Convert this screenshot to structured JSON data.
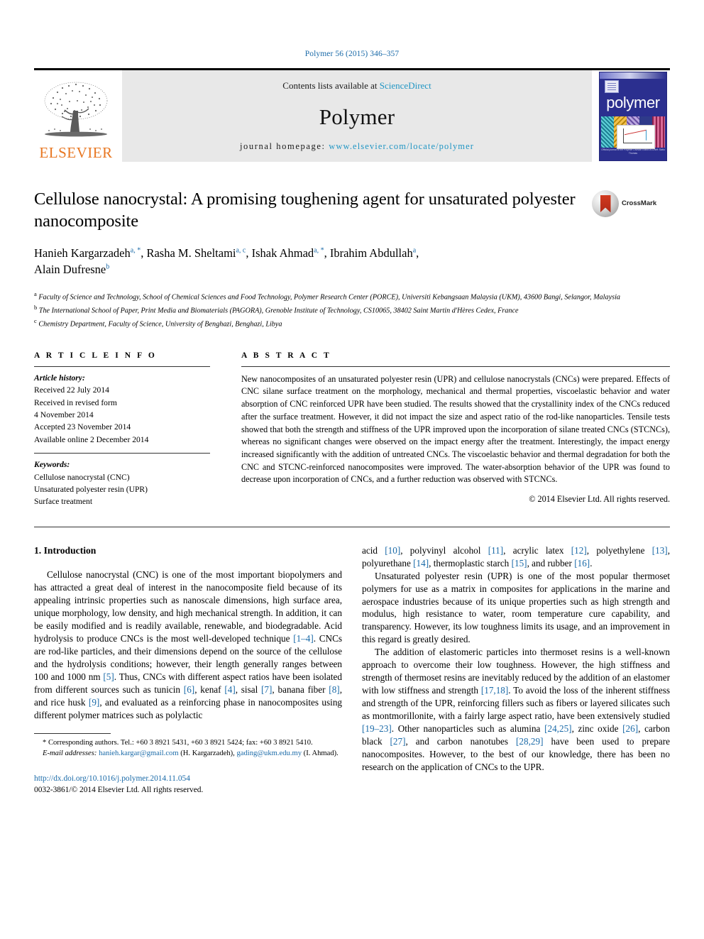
{
  "running_head": "Polymer 56 (2015) 346–357",
  "masthead": {
    "publisher": "ELSEVIER",
    "contents_prefix": "Contents lists available at ",
    "contents_link": "ScienceDirect",
    "journal_title": "Polymer",
    "homepage_prefix": "journal homepage: ",
    "homepage_url": "www.elsevier.com/locate/polymer",
    "cover_word": "polymer",
    "cover_footer": "Official journal of the Polymer Division\nEditor-in-Chief: Sabu Thomas"
  },
  "article": {
    "title": "Cellulose nanocrystal: A promising toughening agent for unsaturated polyester nanocomposite",
    "crossmark_label": "CrossMark",
    "authors": [
      {
        "name": "Hanieh Kargarzadeh",
        "marks": "a, *",
        "sep": ", "
      },
      {
        "name": "Rasha M. Sheltami",
        "marks": "a, c",
        "sep": ", "
      },
      {
        "name": "Ishak Ahmad",
        "marks": "a, *",
        "sep": ", "
      },
      {
        "name": "Ibrahim Abdullah",
        "marks": "a",
        "sep": ","
      },
      {
        "name": "Alain Dufresne",
        "marks": "b",
        "sep": ""
      }
    ],
    "affiliations": [
      {
        "mark": "a",
        "text": "Faculty of Science and Technology, School of Chemical Sciences and Food Technology, Polymer Research Center (PORCE), Universiti Kebangsaan Malaysia (UKM), 43600 Bangi, Selangor, Malaysia"
      },
      {
        "mark": "b",
        "text": "The International School of Paper, Print Media and Biomaterials (PAGORA), Grenoble Institute of Technology, CS10065, 38402 Saint Martin d'Hères Cedex, France"
      },
      {
        "mark": "c",
        "text": "Chemistry Department, Faculty of Science, University of Benghazi, Benghazi, Libya"
      }
    ]
  },
  "article_info": {
    "heading": "A R T I C L E   I N F O",
    "history_label": "Article history:",
    "history": [
      "Received 22 July 2014",
      "Received in revised form",
      "4 November 2014",
      "Accepted 23 November 2014",
      "Available online 2 December 2014"
    ],
    "keywords_label": "Keywords:",
    "keywords": [
      "Cellulose nanocrystal (CNC)",
      "Unsaturated polyester resin (UPR)",
      "Surface treatment"
    ]
  },
  "abstract": {
    "heading": "A B S T R A C T",
    "text": "New nanocomposites of an unsaturated polyester resin (UPR) and cellulose nanocrystals (CNCs) were prepared. Effects of CNC silane surface treatment on the morphology, mechanical and thermal properties, viscoelastic behavior and water absorption of CNC reinforced UPR have been studied. The results showed that the crystallinity index of the CNCs reduced after the surface treatment. However, it did not impact the size and aspect ratio of the rod-like nanoparticles. Tensile tests showed that both the strength and stiffness of the UPR improved upon the incorporation of silane treated CNCs (STCNCs), whereas no significant changes were observed on the impact energy after the treatment. Interestingly, the impact energy increased significantly with the addition of untreated CNCs. The viscoelastic behavior and thermal degradation for both the CNC and STCNC-reinforced nanocomposites were improved. The water-absorption behavior of the UPR was found to decrease upon incorporation of CNCs, and a further reduction was observed with STCNCs.",
    "copyright": "© 2014 Elsevier Ltd. All rights reserved."
  },
  "body": {
    "section_number_title": "1.  Introduction",
    "left_paragraph_1_a": "Cellulose nanocrystal (CNC) is one of the most important biopolymers and has attracted a great deal of interest in the nanocomposite field because of its appealing intrinsic properties such as nanoscale dimensions, high surface area, unique morphology, low density, and high mechanical strength. In addition, it can be easily modified and is readily available, renewable, and biodegradable. Acid hydrolysis to produce CNCs is the most well-developed technique ",
    "ref_1_4": "[1–4]",
    "left_paragraph_1_b": ". CNCs are rod-like particles, and their dimensions depend on the source of the cellulose and the hydrolysis conditions; however, their length generally ranges between 100 and 1000 nm ",
    "ref_5": "[5]",
    "left_paragraph_1_c": ". Thus, CNCs with different aspect ratios have been isolated from different sources such as tunicin ",
    "ref_6": "[6]",
    "left_paragraph_1_d": ", kenaf ",
    "ref_4": "[4]",
    "left_paragraph_1_e": ", sisal ",
    "ref_7": "[7]",
    "left_paragraph_1_f": ", banana fiber ",
    "ref_8": "[8]",
    "left_paragraph_1_g": ", and rice husk ",
    "ref_9": "[9]",
    "left_paragraph_1_h": ", and evaluated as a reinforcing phase in nanocomposites using different polymer matrices such as polylactic",
    "right_paragraph_1_a": "acid ",
    "ref_10": "[10]",
    "right_paragraph_1_b": ", polyvinyl alcohol ",
    "ref_11": "[11]",
    "right_paragraph_1_c": ", acrylic latex ",
    "ref_12": "[12]",
    "right_paragraph_1_d": ", polyethylene ",
    "ref_13": "[13]",
    "right_paragraph_1_e": ", polyurethane ",
    "ref_14": "[14]",
    "right_paragraph_1_f": ", thermoplastic starch ",
    "ref_15": "[15]",
    "right_paragraph_1_g": ", and rubber ",
    "ref_16": "[16]",
    "right_paragraph_1_h": ".",
    "right_paragraph_2": "Unsaturated polyester resin (UPR) is one of the most popular thermoset polymers for use as a matrix in composites for applications in the marine and aerospace industries because of its unique properties such as high strength and modulus, high resistance to water, room temperature cure capability, and transparency. However, its low toughness limits its usage, and an improvement in this regard is greatly desired.",
    "right_paragraph_3_a": "The addition of elastomeric particles into thermoset resins is a well-known approach to overcome their low toughness. However, the high stiffness and strength of thermoset resins are inevitably reduced by the addition of an elastomer with low stiffness and strength ",
    "ref_17_18": "[17,18]",
    "right_paragraph_3_b": ". To avoid the loss of the inherent stiffness and strength of the UPR, reinforcing fillers such as fibers or layered silicates such as montmorillonite, with a fairly large aspect ratio, have been extensively studied ",
    "ref_19_23": "[19–23]",
    "right_paragraph_3_c": ". Other nanoparticles such as alumina ",
    "ref_24_25": "[24,25]",
    "right_paragraph_3_d": ", zinc oxide ",
    "ref_26": "[26]",
    "right_paragraph_3_e": ", carbon black ",
    "ref_27": "[27]",
    "right_paragraph_3_f": ", and carbon nanotubes ",
    "ref_28_29": "[28,29]",
    "right_paragraph_3_g": " have been used to prepare nanocomposites. However, to the best of our knowledge, there has been no research on the application of CNCs to the UPR."
  },
  "footnotes": {
    "corresponding": "* Corresponding authors. Tel.: +60 3 8921 5431, +60 3 8921 5424; fax: +60 3 8921 5410.",
    "email_label": "E-mail addresses:",
    "email_1": "hanieh.kargar@gmail.com",
    "email_1_owner": " (H. Kargarzadeh), ",
    "email_2": "gading@ukm.edu.my",
    "email_2_owner": " (I. Ahmad)."
  },
  "footer": {
    "doi": "http://dx.doi.org/10.1016/j.polymer.2014.11.054",
    "issn_line": "0032-3861/© 2014 Elsevier Ltd. All rights reserved."
  },
  "colors": {
    "link_blue": "#1a6aa8",
    "sciencedirect_blue": "#2196c4",
    "elsevier_orange": "#E87722",
    "cover_navy": "#2b2f8f",
    "band_gray": "#e8e8e8"
  }
}
